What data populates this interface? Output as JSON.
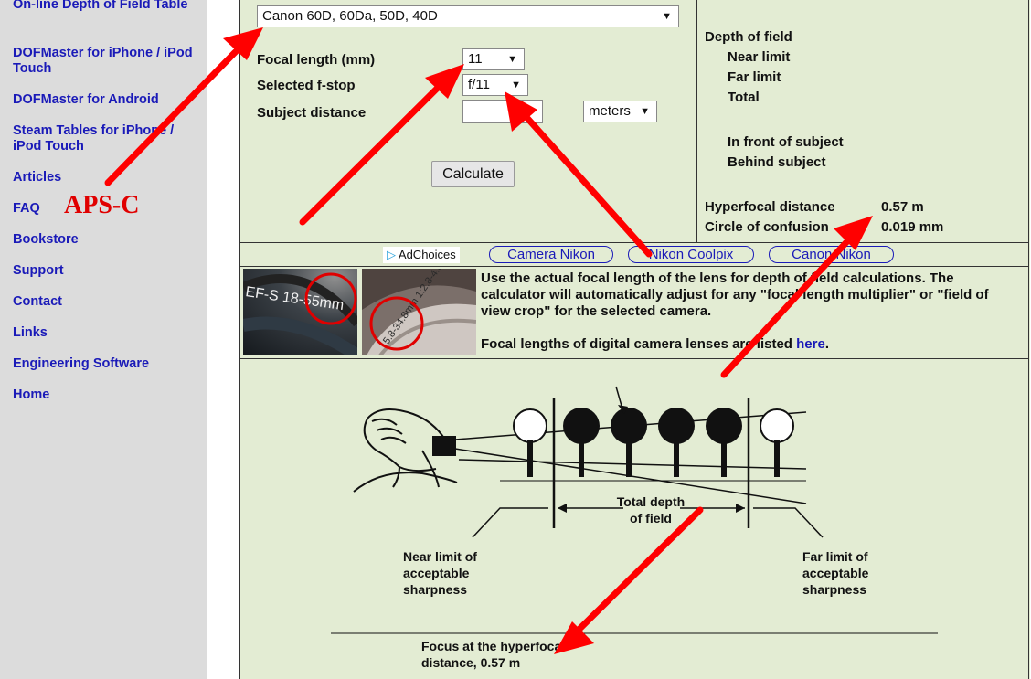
{
  "sidebar": {
    "items": [
      {
        "label": "On-line Depth of Field Table"
      },
      {
        "label": "DOFMaster for iPhone / iPod Touch"
      },
      {
        "label": "DOFMaster for Android"
      },
      {
        "label": "Steam Tables for iPhone / iPod Touch"
      },
      {
        "label": "Articles"
      },
      {
        "label": "FAQ"
      },
      {
        "label": "Bookstore"
      },
      {
        "label": "Support"
      },
      {
        "label": "Contact"
      },
      {
        "label": "Links"
      },
      {
        "label": "Engineering Software"
      },
      {
        "label": "Home"
      }
    ],
    "annotation": "APS-C"
  },
  "calculator": {
    "camera_value": "Canon 60D, 60Da, 50D, 40D",
    "focal_length_label": "Focal length (mm)",
    "focal_length_value": "11",
    "fstop_label": "Selected f-stop",
    "fstop_value": "f/11",
    "distance_label": "Subject distance",
    "distance_value": "",
    "unit_value": "meters",
    "calculate_label": "Calculate"
  },
  "results": {
    "dof_heading": "Depth of field",
    "near_label": "Near limit",
    "far_label": "Far limit",
    "total_label": "Total",
    "front_label": "In front of subject",
    "behind_label": "Behind subject",
    "hyperfocal_label": "Hyperfocal distance",
    "hyperfocal_value": "0.57 m",
    "coc_label": "Circle of confusion",
    "coc_value": "0.019 mm"
  },
  "ads": {
    "adchoices_label": "AdChoices",
    "links": [
      "Camera Nikon",
      "Nikon Coolpix",
      "Canon Nikon"
    ]
  },
  "info": {
    "line1": "Use the actual focal length of the lens for depth of field calculations. The calculator will automatically adjust for any \"focal length multiplier\" or \"field of view crop\" for the selected camera.",
    "line2_prefix": "Focal lengths of digital camera lenses are listed ",
    "line2_link": "here",
    "line2_suffix": ".",
    "photo1_text": "EF-S 18-55mm",
    "photo2_text": "5.8-34.8mm 1:2.8-4.8"
  },
  "diagram": {
    "total_dof": "Total depth of field",
    "near_limit": "Near limit of acceptable sharpness",
    "far_limit": "Far limit of acceptable sharpness",
    "caption": "Focus at the hyperfocal distance, 0.57 m"
  },
  "colors": {
    "sidebar_bg": "#dcdcdc",
    "main_bg": "#e3ecd3",
    "link": "#1a1ab8",
    "annotation_red": "#ff0000"
  }
}
